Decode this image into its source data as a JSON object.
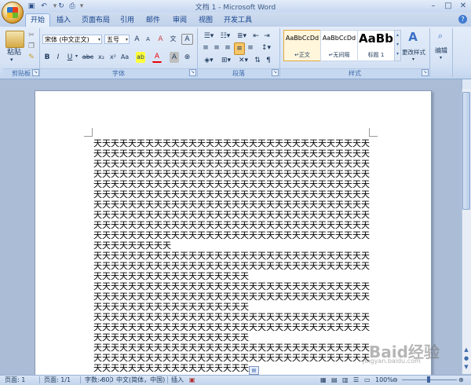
{
  "window": {
    "title": "文档 1 - Microsoft Word",
    "controls": [
      "minimize-icon",
      "maximize-icon",
      "close-icon"
    ]
  },
  "quick_access": [
    "save-icon",
    "undo-icon",
    "redo-icon",
    "print-preview-icon"
  ],
  "tabs": [
    {
      "label": "开始",
      "active": true
    },
    {
      "label": "插入"
    },
    {
      "label": "页面布局"
    },
    {
      "label": "引用"
    },
    {
      "label": "邮件"
    },
    {
      "label": "审阅"
    },
    {
      "label": "视图"
    },
    {
      "label": "开发工具"
    }
  ],
  "ribbon": {
    "clipboard": {
      "label": "剪贴板",
      "paste": "粘贴"
    },
    "font": {
      "label": "字体",
      "font_name": "宋体 (中文正文)",
      "font_size": "五号",
      "bold": "B",
      "italic": "I",
      "underline": "U",
      "strike": "abc",
      "subscript": "x₂",
      "superscript": "x²",
      "change_case": "Aa",
      "highlight": "ab",
      "font_color": "A",
      "char_shading": "A",
      "grow": "A",
      "shrink": "A",
      "phonetic": "文",
      "clear_format": "A",
      "char_border": "A"
    },
    "paragraph": {
      "label": "段落"
    },
    "styles": {
      "label": "样式",
      "items": [
        {
          "preview": "AaBbCcDd",
          "name": "↵正文",
          "selected": true
        },
        {
          "preview": "AaBbCcDd",
          "name": "↵无间隔"
        },
        {
          "preview": "AaBb",
          "name": "标题 1"
        }
      ],
      "change_styles": "更改样式"
    },
    "editing": {
      "label": "编辑"
    }
  },
  "document": {
    "lines": [
      "天天天天天天天天天天天天天天天天天天天天天天天天天天天天天天天天天",
      "天天天天天天天天天天天天天天天天天天天天天天天天天天天天天天天天天",
      "天天天天天天天天天天天天天天天天天天天天天天天天天天天天天天天天天",
      "天天天天天天天天天天天天天天天天天天天天天天天天天天天天天天天天天",
      "天天天天天天天天天天天天天天天天天天天天天天天天天天天天天天天天天",
      "天天天天天天天天天天天天天天天天天天天天天天天天天天天天天天天天天",
      "天天天天天天天天天天天天天天天天天天天天天天天天天天天天天天天天天",
      "天天天天天天天天天天天天天天天天天天天天天天天天天天天天天天天天天",
      "天天天天天天天天天天天天天天天天天天天天天天天天天天天天天天天天天",
      "天天天天天天天天天天天天天天天天天天天天天天天天天天天天天天天天天",
      "天天天天天天天天天",
      "天天天天天天天天天天天天天天天天天天天天天天天天天天天天天天天天天",
      "天天天天天天天天天天天天天天天天天天天天天天天天天天天天天天天天天",
      "天天天天天天天天天天天天天天天天天天",
      "天天天天天天天天天天天天天天天天天天天天天天天天天天天天天天天天天",
      "天天天天天天天天天天天天天天天天天天天天天天天天天天天天天天天天天",
      "天天天天天天天天天天天天天天天天天天",
      "天天天天天天天天天天天天天天天天天天天天天天天天天天天天天天天天天",
      "天天天天天天天天天天天天天天天天天天天天天天天天天天天天天天天天天",
      "天天天天天天天天天天天天天天天天天天",
      "天天天天天天天天天天天天天天天天天天天天天天天天天天天天天天天天天",
      "天天天天天天天天天天天天天天天天天天天天天天天天天天天天天天天天天",
      "天天天天天天天天天天天天天天天天天天"
    ]
  },
  "status": {
    "page": "页面: 1",
    "pages": "页面: 1/1",
    "words": "字数: 800",
    "language": "中文(简体，中国)",
    "mode": "插入",
    "zoom": "100%"
  },
  "watermark": {
    "main": "Baid经验",
    "sub": "jingyan.baidu.com"
  }
}
